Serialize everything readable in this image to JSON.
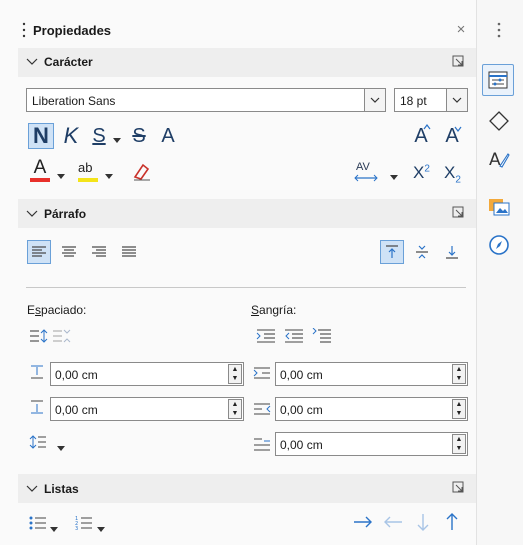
{
  "panel": {
    "title": "Propiedades"
  },
  "caracter": {
    "title": "Carácter",
    "font_name": "Liberation Sans",
    "font_size": "18 pt",
    "bold_glyph": "N",
    "italic_glyph": "K",
    "underline_glyph": "S",
    "strike_glyph": "S",
    "shadow_glyph": "A",
    "grow_glyph": "A",
    "shrink_glyph": "A",
    "fontcolor_glyph": "A",
    "highlight_glyph": "ab",
    "spacing_glyph": "AV",
    "super_glyph": "X",
    "super_exp": "2",
    "sub_glyph": "X",
    "sub_exp": "2"
  },
  "parrafo": {
    "title": "Párrafo",
    "espaciado_label_pre": "E",
    "espaciado_label_u": "s",
    "espaciado_label_post": "paciado:",
    "sangria_label_u": "S",
    "sangria_label_post": "angría:",
    "above_spacing": "0,00 cm",
    "below_spacing": "0,00 cm",
    "indent_before": "0,00 cm",
    "indent_after": "0,00 cm",
    "first_line": "0,00 cm"
  },
  "listas": {
    "title": "Listas"
  },
  "colors": {
    "accent": "#2a73c8",
    "highlight": "#cfe2f6",
    "font_color_bar": "#e8302a",
    "highlight_bar": "#f4e41a"
  }
}
